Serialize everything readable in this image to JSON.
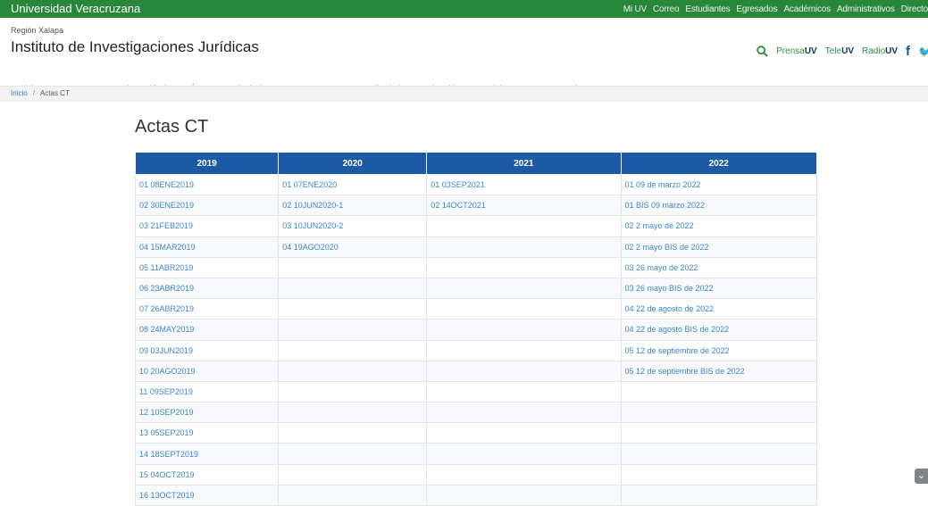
{
  "topbar": {
    "brand": "Universidad Veracruzana",
    "links": [
      "Mi UV",
      "Correo",
      "Estudiantes",
      "Egresados",
      "Académicos",
      "Administrativos",
      "Directo"
    ]
  },
  "header": {
    "region": "Región Xalapa",
    "institute": "Instituto de Investigaciones Jurídicas",
    "media": [
      {
        "prefix": "Prensa",
        "suffix": "UV"
      },
      {
        "prefix": "Tele",
        "suffix": "UV"
      },
      {
        "prefix": "Radio",
        "suffix": "UV"
      }
    ]
  },
  "nav": [
    {
      "label": "Inicio",
      "dropdown": false
    },
    {
      "label": "Nosotros",
      "dropdown": true
    },
    {
      "label": "Personal Académico",
      "dropdown": true
    },
    {
      "label": "Órganos Colegiados",
      "dropdown": true
    },
    {
      "label": "Programas",
      "dropdown": true
    },
    {
      "label": "Desarrollo de la Investigación",
      "dropdown": true
    },
    {
      "label": "Servicios",
      "dropdown": true
    },
    {
      "label": "Transparencia",
      "dropdown": false
    }
  ],
  "breadcrumb": {
    "home": "Inicio",
    "separator": "/",
    "current": "Actas CT"
  },
  "page_title": "Actas CT",
  "table": {
    "headers": [
      "2019",
      "2020",
      "2021",
      "2022"
    ],
    "rows": [
      [
        "01 08ENE2019",
        "01 07ENE2020",
        "01 03SEP2021",
        "01 09 de marzo 2022"
      ],
      [
        "02 30ENE2019",
        "02 10JUN2020-1",
        "02 14OCT2021",
        "01 BIS 09 marzo 2022"
      ],
      [
        "03 21FEB2019",
        "03 10JUN2020-2",
        "",
        "02 2 mayo de 2022"
      ],
      [
        "04 15MAR2019",
        "04 19AGO2020",
        "",
        "02 2 mayo BIS de 2022"
      ],
      [
        "05 11ABR2019",
        "",
        "",
        "03 26 mayo de 2022"
      ],
      [
        "06 23ABR2019",
        "",
        "",
        "03 26 mayo BIS de 2022"
      ],
      [
        "07 26ABR2019",
        "",
        "",
        "04 22 de agosto de 2022"
      ],
      [
        "08 24MAY2019",
        "",
        "",
        "04 22 de agosto BIS de 2022"
      ],
      [
        "09 03JUN2019",
        "",
        "",
        "05 12 de septiembre de 2022"
      ],
      [
        "10 20AGO2019",
        "",
        "",
        "05 12 de septiembre BIS de 2022"
      ],
      [
        "11 09SEP2019",
        "",
        "",
        ""
      ],
      [
        "12 10SEP2019",
        "",
        "",
        ""
      ],
      [
        "13 05SEP2019",
        "",
        "",
        ""
      ],
      [
        "14 18SEPT2019",
        "",
        "",
        ""
      ],
      [
        "15 04OCT2019",
        "",
        "",
        ""
      ],
      [
        "16 13OCT2019",
        "",
        "",
        ""
      ]
    ]
  },
  "colors": {
    "topbar": "#28873a",
    "table_header": "#1c5aa6",
    "link": "#3d85c6"
  },
  "icons": [
    "search-icon",
    "facebook-icon",
    "twitter-icon",
    "chevron-down-icon"
  ]
}
